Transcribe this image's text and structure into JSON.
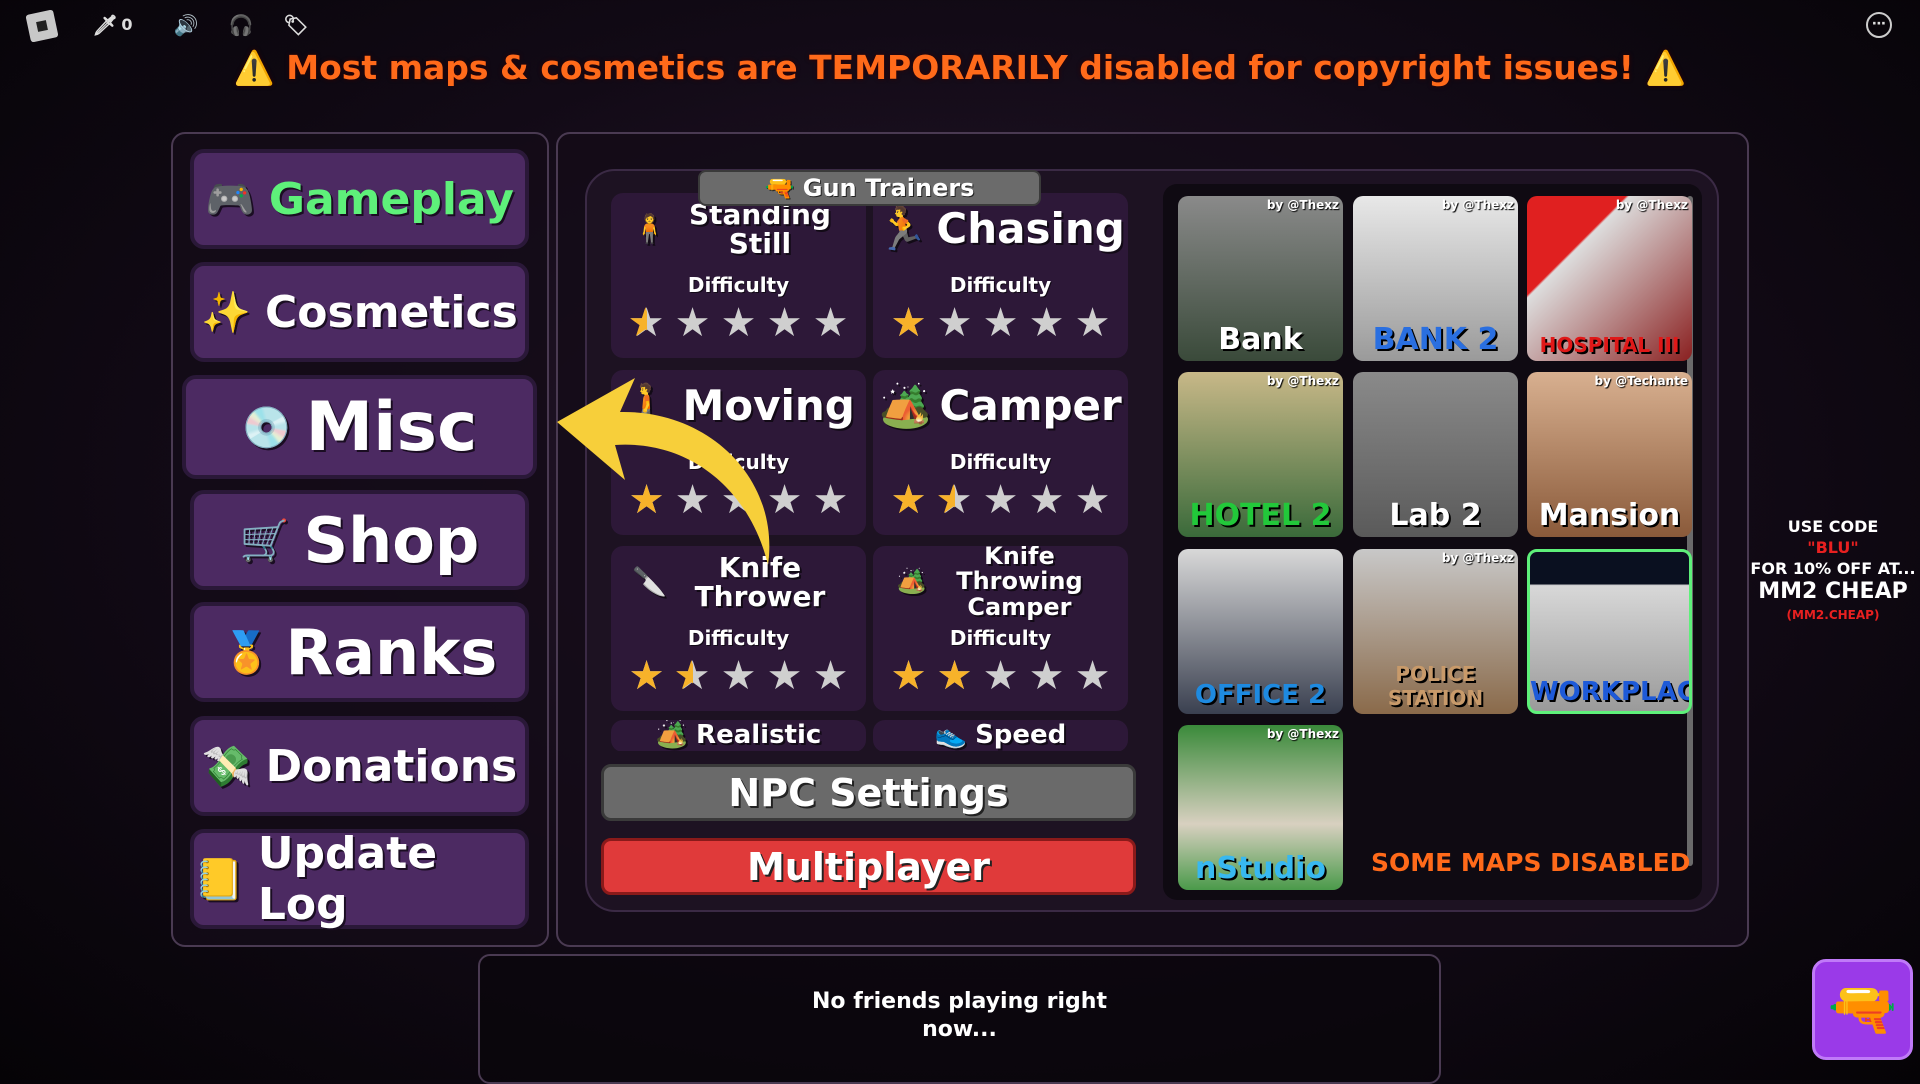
{
  "topbar": {
    "kills_count": "0",
    "icons": [
      "roblox-logo",
      "sword-icon",
      "speaker-icon",
      "headset-icon",
      "tag-icon",
      "more-icon"
    ]
  },
  "banner": {
    "text": "⚠️ Most maps & cosmetics are TEMPORARILY disabled for copyright issues! ⚠️",
    "color": "#ff6a1a"
  },
  "sidebar": {
    "items": [
      {
        "label": "Gameplay",
        "icon": "🎮",
        "active": true,
        "color": "#5ef07a"
      },
      {
        "label": "Cosmetics",
        "icon": "✨"
      },
      {
        "label": "Misc",
        "icon": "💿"
      },
      {
        "label": "Shop",
        "icon": "🛒"
      },
      {
        "label": "Ranks",
        "icon": "🏅"
      },
      {
        "label": "Donations",
        "icon": "💸"
      },
      {
        "label": "Update Log",
        "icon": "📒"
      }
    ]
  },
  "trainers": {
    "tab_label": "Gun Trainers",
    "tab_icon": "🔫",
    "difficulty_label": "Difficulty",
    "cards": [
      {
        "title": "Standing Still",
        "icon": "🧍",
        "rating": 0.5
      },
      {
        "title": "Chasing",
        "icon": "🏃",
        "rating": 1
      },
      {
        "title": "Moving",
        "icon": "🚶",
        "rating": 1
      },
      {
        "title": "Camper",
        "icon": "🏕️",
        "rating": 1.5
      },
      {
        "title": "Knife Thrower",
        "icon": "🔪",
        "rating": 1.5
      },
      {
        "title": "Knife Throwing Camper",
        "icon": "🏕️",
        "rating": 2
      },
      {
        "title": "Realistic",
        "icon": "🏕️"
      },
      {
        "title": "Speed",
        "icon": "👟"
      }
    ],
    "npc_settings": "NPC Settings",
    "multiplayer": "Multiplayer"
  },
  "maps": {
    "items": [
      {
        "name": "Bank",
        "author": "by @Thexz",
        "label_color": "#ffffff"
      },
      {
        "name": "BANK 2",
        "author": "by @Thexz",
        "label_color": "#2a6fe0"
      },
      {
        "name": "HOSPITAL III",
        "author": "by @Thexz",
        "label_color": "#e01818"
      },
      {
        "name": "HOTEL 2",
        "author": "by @Thexz",
        "label_color": "#22c83a"
      },
      {
        "name": "Lab 2",
        "author": "",
        "label_color": "#ffffff"
      },
      {
        "name": "Mansion",
        "author": "by @Techante",
        "label_color": "#ffffff"
      },
      {
        "name": "OFFICE 2",
        "author": "",
        "label_color": "#1e8ae0"
      },
      {
        "name": "POLICE STATION",
        "author": "by @Thexz",
        "label_color": "#c89a6a"
      },
      {
        "name": "WORKPLACE",
        "author": "",
        "label_color": "#1e5ad8",
        "selected": true
      },
      {
        "name": "nStudio",
        "author": "by @Thexz",
        "label_color": "#38b8f0"
      }
    ],
    "notice": "SOME MAPS DISABLED"
  },
  "friends": {
    "text": "No friends playing right now..."
  },
  "ad": {
    "line1": "USE CODE",
    "code": "\"BLU\"",
    "line2": "FOR 10% OFF AT...",
    "logo": "MM2 CHEAP",
    "url": "(MM2.CHEAP)"
  }
}
